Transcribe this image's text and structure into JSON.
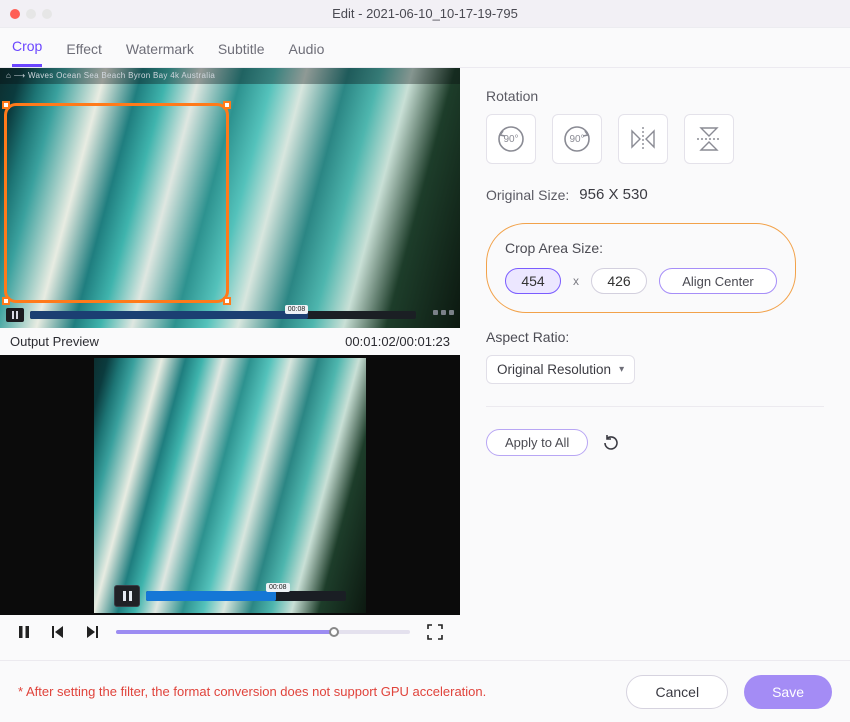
{
  "window": {
    "title": "Edit - 2021-06-10_10-17-19-795"
  },
  "tabs": {
    "crop": "Crop",
    "effect": "Effect",
    "watermark": "Watermark",
    "subtitle": "Subtitle",
    "audio": "Audio",
    "active": "crop"
  },
  "source": {
    "breadcrumbs": "⌂ ⟶ Waves  Ocean  Sea  Beach  Byron Bay  4k  Australia",
    "mini_time": "00:08"
  },
  "preview": {
    "label": "Output Preview",
    "timecode": "00:01:02/00:01:23",
    "mini_time": "00:08"
  },
  "panel": {
    "rotation_label": "Rotation",
    "rotate_ccw": "90°",
    "rotate_cw": "90°",
    "original_size_label": "Original Size:",
    "original_size_value": "956 X 530",
    "crop_area_label": "Crop Area Size:",
    "crop_w": "454",
    "crop_h": "426",
    "crop_sep": "x",
    "align_center": "Align Center",
    "aspect_label": "Aspect Ratio:",
    "aspect_value": "Original Resolution",
    "apply_all": "Apply to All"
  },
  "footer": {
    "warning": "* After setting the filter, the format conversion does not support GPU acceleration.",
    "cancel": "Cancel",
    "save": "Save"
  }
}
